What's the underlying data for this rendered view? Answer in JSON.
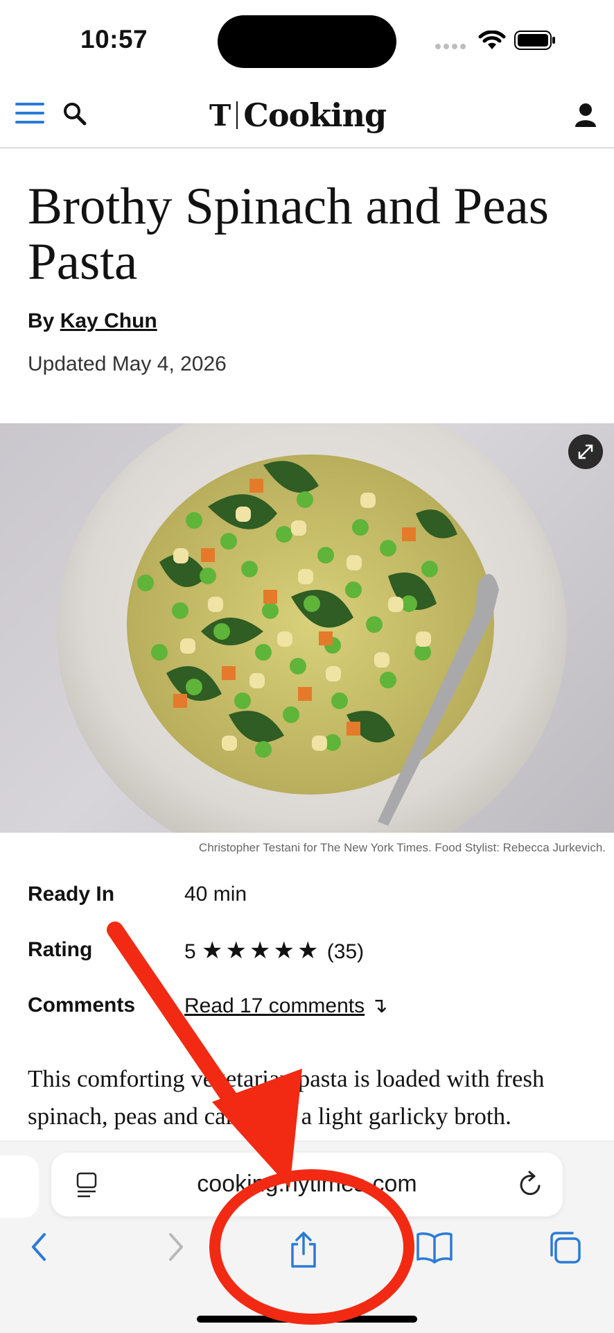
{
  "status_bar": {
    "time": "10:57"
  },
  "header": {
    "brand_mark": "T",
    "brand_name": "Cooking",
    "icons": [
      "hamburger-menu-icon",
      "search-icon",
      "account-icon"
    ]
  },
  "recipe": {
    "title": "Brothy Spinach and Peas Pasta",
    "byline_prefix": "By",
    "author": "Kay Chun",
    "updated": "Updated May 4, 2026",
    "photo_caption": "Christopher Testani for The New York Times. Food Stylist: Rebecca Jurkevich.",
    "info": {
      "ready_in_label": "Ready In",
      "ready_in_value": "40 min",
      "rating_label": "Rating",
      "rating_value": "5",
      "rating_stars": "★★★★★",
      "rating_count": "(35)",
      "comments_label": "Comments",
      "comments_link": "Read 17 comments",
      "comments_arrow": "↴"
    },
    "description": "This comforting vegetarian pasta is loaded with fresh spinach, peas and carrots in a light garlicky broth."
  },
  "browser": {
    "url": "cooking.nytimes.com",
    "toolbar": [
      "back-icon",
      "forward-icon",
      "share-icon",
      "bookmarks-icon",
      "tabs-icon"
    ]
  },
  "colors": {
    "accent_blue": "#2a7bd7",
    "annotation_red": "#f22a13"
  }
}
